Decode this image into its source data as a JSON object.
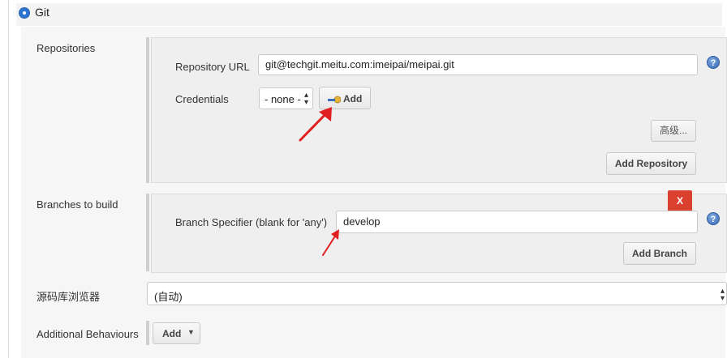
{
  "git": {
    "label": "Git"
  },
  "repositories": {
    "label": "Repositories",
    "url_label": "Repository URL",
    "url_value": "git@techgit.meitu.com:imeipai/meipai.git",
    "credentials_label": "Credentials",
    "credentials_value": "- none -",
    "add_credentials_label": "Add",
    "advanced_label": "高级...",
    "add_repository_label": "Add Repository"
  },
  "branches": {
    "label": "Branches to build",
    "delete_label": "X",
    "specifier_label": "Branch Specifier (blank for 'any')",
    "specifier_value": "develop",
    "add_branch_label": "Add Branch"
  },
  "browser": {
    "label": "源码库浏览器",
    "value": "(自动)"
  },
  "behaviours": {
    "label": "Additional Behaviours",
    "add_label": "Add"
  },
  "help_glyph": "?",
  "icons": [
    "radio-selected-icon",
    "key-icon",
    "help-icon",
    "dropdown-arrow-icon",
    "annotation-arrow-icon"
  ],
  "colors": {
    "accent": "#2f74d0",
    "delete": "#d9412e",
    "annotation": "#e02020"
  }
}
